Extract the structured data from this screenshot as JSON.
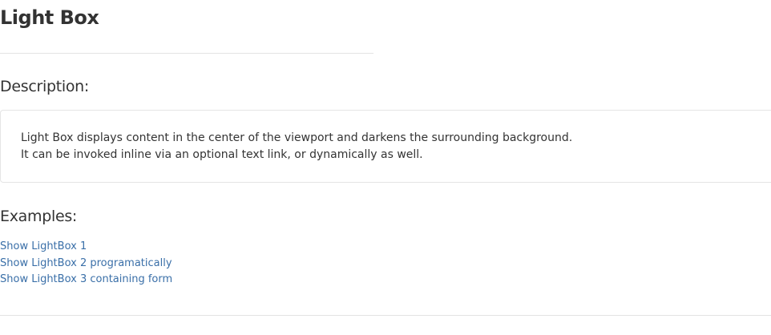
{
  "page": {
    "title": "Light Box"
  },
  "description": {
    "heading": "Description:",
    "lines": [
      "Light Box displays content in the center of the viewport and darkens the surrounding background.",
      "It can be invoked inline via an optional text link, or dynamically as well."
    ]
  },
  "examples": {
    "heading": "Examples:",
    "links": [
      {
        "label": "Show LightBox 1"
      },
      {
        "label": "Show LightBox 2 programatically"
      },
      {
        "label": "Show LightBox 3 containing form"
      }
    ]
  },
  "colors": {
    "text": "#333333",
    "link": "#3a6fa8",
    "divider": "#e3e3e3",
    "box_border": "#e5e5e5"
  }
}
